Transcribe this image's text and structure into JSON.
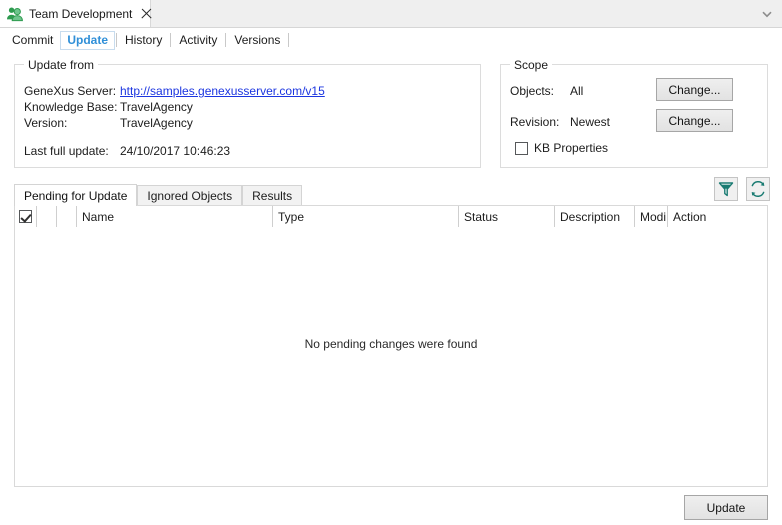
{
  "window": {
    "tab_title": "Team Development",
    "tab_icon": "team-people-icon",
    "close_icon": "close-icon",
    "overflow_icon": "chevron-down-icon"
  },
  "subtabs": [
    {
      "label": "Commit",
      "selected": false
    },
    {
      "label": "Update",
      "selected": true
    },
    {
      "label": "History",
      "selected": false
    },
    {
      "label": "Activity",
      "selected": false
    },
    {
      "label": "Versions",
      "selected": false
    }
  ],
  "update_from": {
    "title": "Update from",
    "server_label": "GeneXus Server:",
    "server_value": "http://samples.genexusserver.com/v15",
    "kb_label": "Knowledge Base:",
    "kb_value": "TravelAgency",
    "version_label": "Version:",
    "version_value": "TravelAgency",
    "last_update_label": "Last full update:",
    "last_update_value": "24/10/2017 10:46:23"
  },
  "scope": {
    "title": "Scope",
    "objects_label": "Objects:",
    "objects_value": "All",
    "objects_change_label": "Change...",
    "revision_label": "Revision:",
    "revision_value": "Newest",
    "revision_change_label": "Change...",
    "kb_properties_label": "KB Properties",
    "kb_properties_checked": false
  },
  "toolbar": {
    "filter_icon": "filter-funnel-icon",
    "refresh_icon": "refresh-icon",
    "icon_color": "#1a7b72"
  },
  "grid_tabs": [
    {
      "label": "Pending for Update",
      "selected": true
    },
    {
      "label": "Ignored Objects",
      "selected": false
    },
    {
      "label": "Results",
      "selected": false
    }
  ],
  "grid": {
    "columns": [
      {
        "label": "",
        "name": "select-all-checkbox-column",
        "width": 22
      },
      {
        "label": "",
        "name": "icon-column-1",
        "width": 20
      },
      {
        "label": "",
        "name": "icon-column-2",
        "width": 20
      },
      {
        "label": "Name",
        "name": "name-column",
        "width": 196
      },
      {
        "label": "Type",
        "name": "type-column",
        "width": 186
      },
      {
        "label": "Status",
        "name": "status-column",
        "width": 96
      },
      {
        "label": "Description",
        "name": "description-column",
        "width": 80
      },
      {
        "label": "Modi",
        "name": "modified-column",
        "width": 33
      },
      {
        "label": "Action",
        "name": "action-column",
        "width": 99
      }
    ],
    "select_all_checked": true,
    "rows": [],
    "empty_message": "No pending changes were found"
  },
  "footer": {
    "update_button_label": "Update"
  }
}
